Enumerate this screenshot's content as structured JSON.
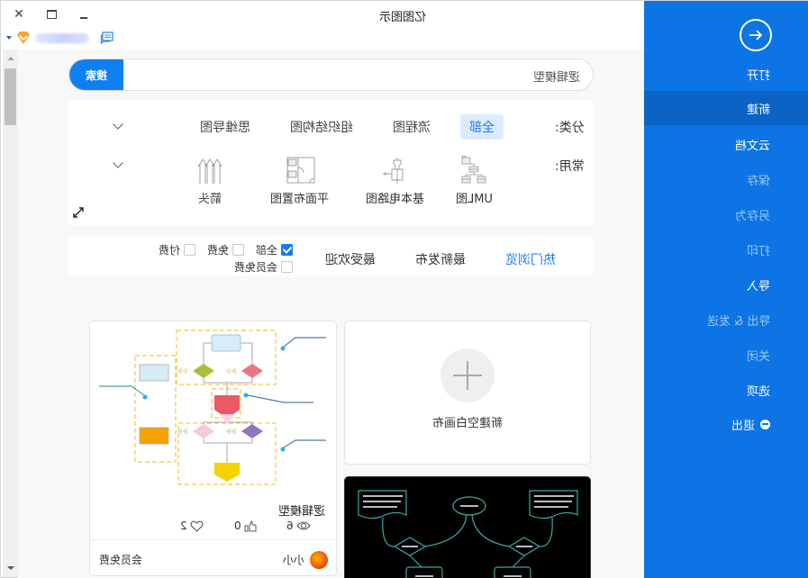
{
  "window": {
    "title": "亿图图示",
    "close_glyph": "✕"
  },
  "search": {
    "button_label": "搜索",
    "value": "逻辑模型",
    "placeholder": ""
  },
  "categories": {
    "label": "分类:",
    "tabs": [
      {
        "label": "全部",
        "active": true
      },
      {
        "label": "流程图",
        "active": false
      },
      {
        "label": "组织结构图",
        "active": false
      },
      {
        "label": "思维导图",
        "active": false
      }
    ]
  },
  "common": {
    "label": "常用:",
    "items": [
      {
        "label": "UML图",
        "icon": "uml-diagram-icon"
      },
      {
        "label": "基本电路图",
        "icon": "circuit-diagram-icon"
      },
      {
        "label": "平面布置图",
        "icon": "floor-plan-icon"
      },
      {
        "label": "箭头",
        "icon": "arrows-icon"
      }
    ]
  },
  "sort_tabs": [
    {
      "label": "热门浏览",
      "active": true
    },
    {
      "label": "最新发布",
      "active": false
    },
    {
      "label": "最受欢迎",
      "active": false
    }
  ],
  "price_filters": [
    {
      "label": "全部",
      "checked": true
    },
    {
      "label": "免费",
      "checked": false
    },
    {
      "label": "付费",
      "checked": false
    },
    {
      "label": "会员免费",
      "checked": false
    }
  ],
  "new_canvas": {
    "label": "新建空白画布"
  },
  "templates": [
    {
      "title": "逻辑模型",
      "views": "6",
      "likes": "0",
      "favorites": "2",
      "author": "小小",
      "price": "会员免费"
    }
  ],
  "sidebar": {
    "items": [
      {
        "label": "打开",
        "state": "normal"
      },
      {
        "label": "新建",
        "state": "active"
      },
      {
        "label": "云文档",
        "state": "normal"
      },
      {
        "label": "保存",
        "state": "dim"
      },
      {
        "label": "另存为",
        "state": "dim"
      },
      {
        "label": "打印",
        "state": "dim"
      },
      {
        "label": "导入",
        "state": "normal"
      },
      {
        "label": "导出 & 发送",
        "state": "dim"
      },
      {
        "label": "关闭",
        "state": "dim"
      },
      {
        "label": "选项",
        "state": "normal"
      },
      {
        "label": "退出",
        "state": "normal"
      }
    ]
  },
  "colors": {
    "accent": "#0f7ff2",
    "sidebar_bg": "#0c74e5",
    "sidebar_active": "#0b63c6",
    "active_tab_bg": "#dcebff",
    "link_blue": "#1677ff"
  }
}
